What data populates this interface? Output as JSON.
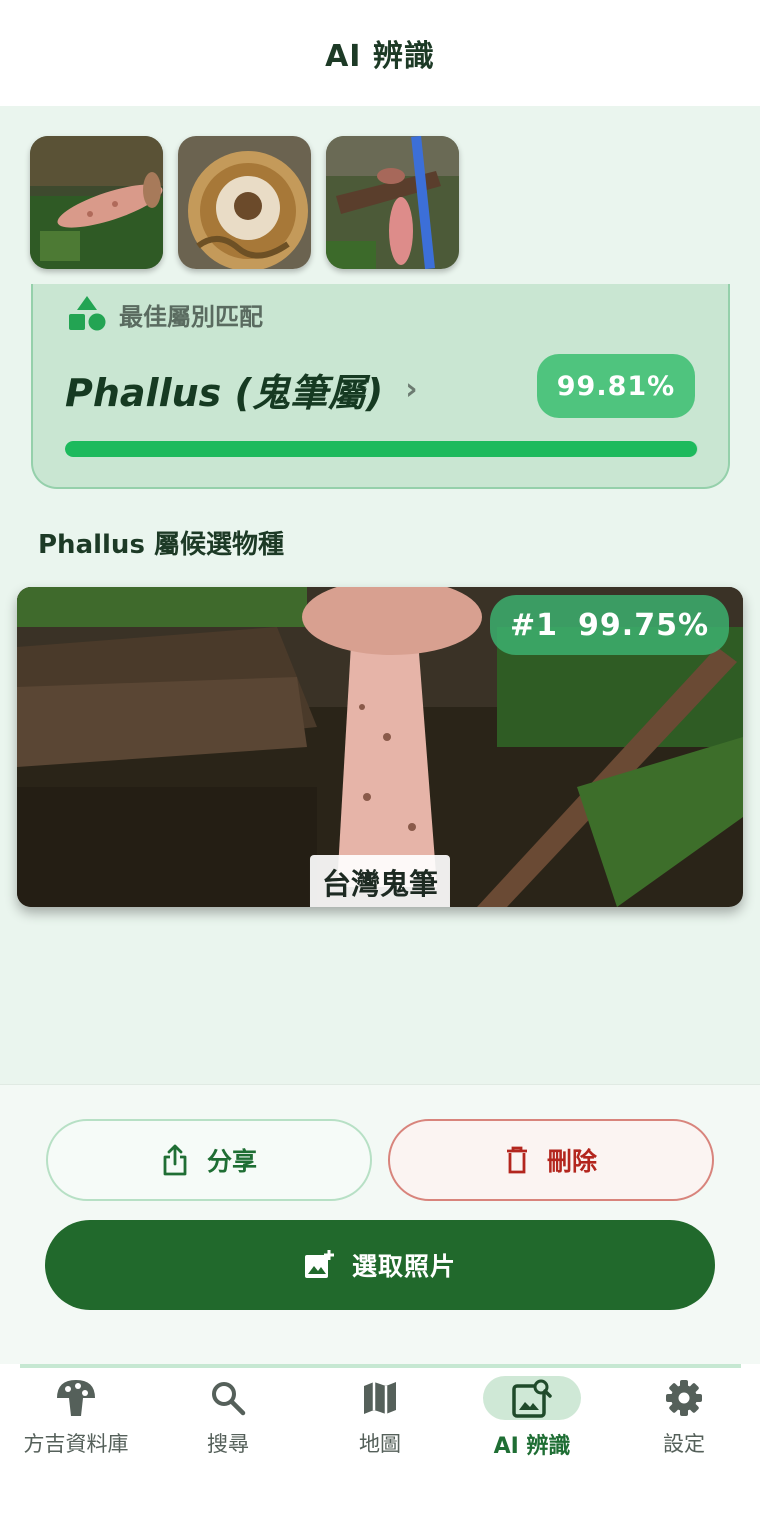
{
  "header": {
    "title": "AI 辨識"
  },
  "thumbnails": [
    {
      "name": "photo-1"
    },
    {
      "name": "photo-2"
    },
    {
      "name": "photo-3"
    }
  ],
  "best_match": {
    "label": "最佳屬別匹配",
    "genus": "Phallus (鬼筆屬)",
    "confidence": "99.81%",
    "progress": 0.9981
  },
  "candidates": {
    "title": "Phallus 屬候選物種",
    "items": [
      {
        "rank": "#1",
        "confidence": "99.75%",
        "name": "台灣鬼筆"
      }
    ]
  },
  "actions": {
    "share_label": "分享",
    "delete_label": "刪除",
    "pick_label": "選取照片"
  },
  "nav": {
    "items": [
      {
        "label": "方吉資料庫",
        "icon": "mushroom-icon"
      },
      {
        "label": "搜尋",
        "icon": "search-icon"
      },
      {
        "label": "地圖",
        "icon": "map-icon"
      },
      {
        "label": "AI 辨識",
        "icon": "image-search-icon",
        "active": true
      },
      {
        "label": "設定",
        "icon": "gear-icon"
      }
    ]
  },
  "colors": {
    "primary": "#21692c",
    "accent": "#1dba5d",
    "danger": "#b3261e",
    "background": "#eaf5ee"
  }
}
